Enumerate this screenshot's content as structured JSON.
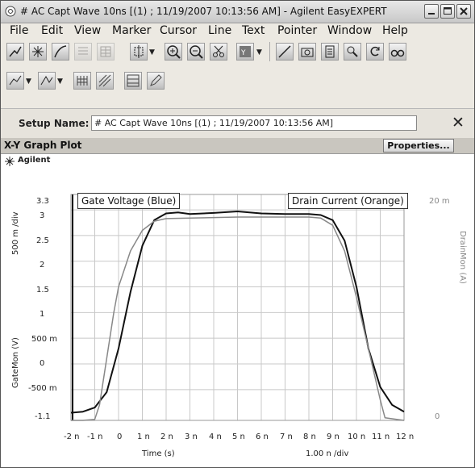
{
  "window": {
    "title": "# AC Capt Wave 10ns [(1) ; 11/19/2007 10:13:56 AM] - Agilent EasyEXPERT"
  },
  "menu": [
    "File",
    "Edit",
    "View",
    "Marker",
    "Cursor",
    "Line",
    "Text",
    "Pointer",
    "Window",
    "Help"
  ],
  "setup": {
    "label": "Setup Name:",
    "value": "# AC Capt Wave 10ns [(1) ; 11/19/2007 10:13:56 AM]",
    "close_glyph": "✕"
  },
  "graph": {
    "panel_title": "X-Y Graph Plot",
    "properties_label": "Properties...",
    "brand": "Agilent"
  },
  "chart_data": {
    "type": "line",
    "x_axis": {
      "label": "Time (s)",
      "div_label": "1.00 n /div",
      "range": [
        -2,
        12
      ],
      "unit": "ns",
      "tick_labels": [
        "-2 n",
        "-1 n",
        "0",
        "1 n",
        "2 n",
        "3 n",
        "4 n",
        "5 n",
        "6 n",
        "7 n",
        "8 n",
        "9 n",
        "10 n",
        "11 n",
        "12 n"
      ]
    },
    "y1_axis": {
      "label": "GateMon (V)",
      "div_label": "500 m /div",
      "range": [
        -1.1,
        3.3
      ],
      "tick_labels": [
        "3.3",
        "3",
        "2.5",
        "2",
        "1.5",
        "1",
        "500 m",
        "0",
        "-500 m",
        "-1.1"
      ]
    },
    "y2_axis": {
      "label": "DrainMon (A)",
      "range": [
        0,
        0.02
      ],
      "tick_labels": [
        "20 m",
        "0"
      ]
    },
    "grid": true,
    "legend": [
      "Gate Voltage (Blue)",
      "Drain Current (Orange)"
    ],
    "series": [
      {
        "name": "Gate Voltage (Blue)",
        "color": "#111111",
        "x": [
          -2,
          -1.5,
          -1,
          -0.5,
          0,
          0.5,
          1,
          1.5,
          2,
          2.5,
          3,
          4,
          5,
          6,
          7,
          8,
          8.5,
          9,
          9.5,
          10,
          10.5,
          11,
          11.5,
          12
        ],
        "y": [
          -0.95,
          -0.93,
          -0.85,
          -0.55,
          0.3,
          1.4,
          2.3,
          2.8,
          2.93,
          2.95,
          2.92,
          2.94,
          2.97,
          2.93,
          2.92,
          2.92,
          2.9,
          2.8,
          2.4,
          1.5,
          0.3,
          -0.45,
          -0.8,
          -0.93
        ]
      },
      {
        "name": "Drain Current (Orange)",
        "color": "#888888",
        "x": [
          -2,
          -1.5,
          -1,
          -0.8,
          -0.6,
          -0.4,
          -0.2,
          0,
          0.5,
          1,
          1.5,
          2,
          3,
          4,
          5,
          6,
          7,
          8,
          8.5,
          9,
          9.5,
          10,
          10.5,
          11,
          11.2,
          12
        ],
        "y": [
          -1.1,
          -1.1,
          -1.08,
          -0.8,
          -0.2,
          0.4,
          1.0,
          1.5,
          2.2,
          2.6,
          2.78,
          2.83,
          2.84,
          2.85,
          2.86,
          2.86,
          2.86,
          2.86,
          2.84,
          2.7,
          2.2,
          1.3,
          0.3,
          -0.7,
          -1.05,
          -1.1
        ]
      }
    ]
  }
}
